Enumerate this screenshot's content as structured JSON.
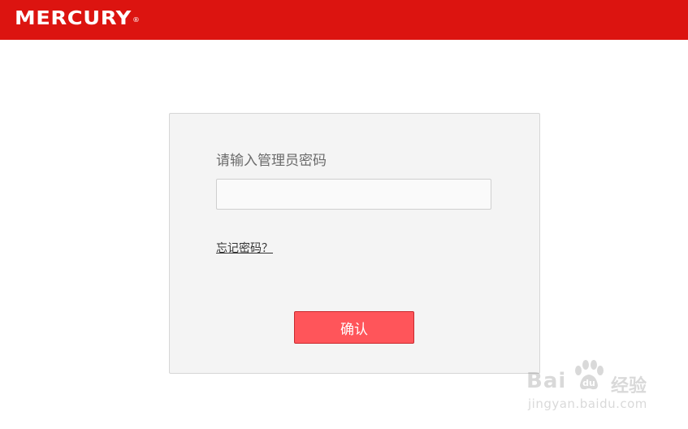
{
  "header": {
    "brand": "MERCURY",
    "brand_mark": "®",
    "color": "#dc1410"
  },
  "login": {
    "password_label": "请输入管理员密码",
    "password_value": "",
    "password_placeholder": "",
    "forgot_link": "忘记密码？",
    "confirm_label": "确认",
    "confirm_color": "#ff555a"
  },
  "watermark": {
    "brand_left": "Bai",
    "brand_right": "经验",
    "url": "jingyan.baidu.com"
  }
}
